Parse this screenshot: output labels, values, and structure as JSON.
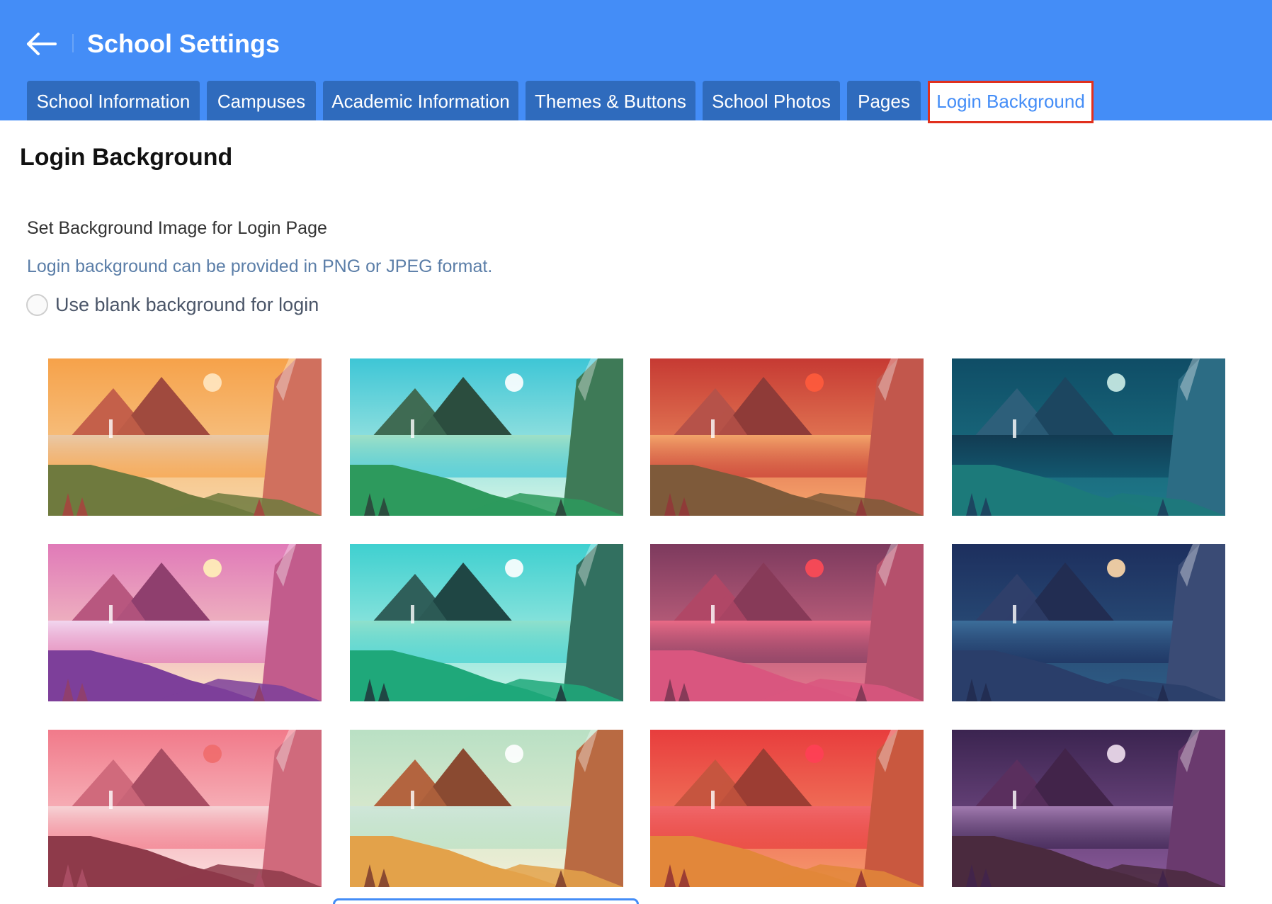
{
  "header": {
    "title": "School Settings",
    "back_icon": "arrow-left-icon",
    "bg_color": "#448df7"
  },
  "tabs": [
    {
      "label": "School Information",
      "active": false
    },
    {
      "label": "Campuses",
      "active": false
    },
    {
      "label": "Academic Information",
      "active": false
    },
    {
      "label": "Themes & Buttons",
      "active": false
    },
    {
      "label": "School Photos",
      "active": false
    },
    {
      "label": "Pages",
      "active": false
    },
    {
      "label": "Login Background",
      "active": true
    }
  ],
  "main": {
    "title": "Login Background",
    "section_label": "Set Background Image for Login Page",
    "hint": "Login background can be provided in PNG or JPEG format.",
    "blank_option_label": "Use blank background for login",
    "blank_option_checked": false
  },
  "backgrounds": [
    {
      "palette": {
        "sky1": "#f6a24a",
        "sky2": "#f7d6a8",
        "mtn": "#c4604a",
        "mtn2": "#a04a3e",
        "water": "#e9c9a8",
        "land": "#6f7a3e",
        "cliff": "#d0705e",
        "orb": "#ffe7c2"
      }
    },
    {
      "palette": {
        "sky1": "#3ec6d6",
        "sky2": "#d9f6e6",
        "mtn": "#3f6b53",
        "mtn2": "#2b4d3e",
        "water": "#9fe0c6",
        "land": "#2d9a5d",
        "cliff": "#3e7a57",
        "orb": "#ffffff"
      }
    },
    {
      "palette": {
        "sky1": "#c63a33",
        "sky2": "#f8a86e",
        "mtn": "#b65249",
        "mtn2": "#8f3b38",
        "water": "#f3a46a",
        "land": "#7e5a3a",
        "cliff": "#c2574c",
        "orb": "#ff5b3c"
      }
    },
    {
      "palette": {
        "sky1": "#0f4d66",
        "sky2": "#1f7a8a",
        "mtn": "#2d5f7a",
        "mtn2": "#1c4660",
        "water": "#123b52",
        "land": "#1c7a7a",
        "cliff": "#2c6c84",
        "orb": "#cdeee8"
      }
    },
    {
      "palette": {
        "sky1": "#e07ab8",
        "sky2": "#fbe4c6",
        "mtn": "#b8577f",
        "mtn2": "#8f3f6e",
        "water": "#f2d6ef",
        "land": "#7d3f9a",
        "cliff": "#c25c8c",
        "orb": "#fff2b8"
      }
    },
    {
      "palette": {
        "sky1": "#3fd0d0",
        "sky2": "#c9f3e6",
        "mtn": "#2f5f5a",
        "mtn2": "#1f4644",
        "water": "#8fe0cc",
        "land": "#1fa87a",
        "cliff": "#327060",
        "orb": "#ffffff"
      }
    },
    {
      "palette": {
        "sky1": "#7d3a5e",
        "sky2": "#e8798f",
        "mtn": "#b04766",
        "mtn2": "#873a58",
        "water": "#e96a86",
        "land": "#d9567f",
        "cliff": "#b5506c",
        "orb": "#ff4a55"
      }
    },
    {
      "palette": {
        "sky1": "#1d2f5e",
        "sky2": "#2f5e86",
        "mtn": "#2f3f6a",
        "mtn2": "#222d52",
        "water": "#3c6e9a",
        "land": "#2a3e6a",
        "cliff": "#3a4b75",
        "orb": "#ffd9a8"
      }
    },
    {
      "palette": {
        "sky1": "#f17a8a",
        "sky2": "#fbe0e0",
        "mtn": "#d06a7c",
        "mtn2": "#a94d63",
        "water": "#f6d3d6",
        "land": "#8e3a4a",
        "cliff": "#d06a7c",
        "orb": "#f06c6c"
      }
    },
    {
      "palette": {
        "sky1": "#b9e0c4",
        "sky2": "#f2efd6",
        "mtn": "#b3643f",
        "mtn2": "#8a4a31",
        "water": "#cfe6d9",
        "land": "#e3a24a",
        "cliff": "#b96a42",
        "orb": "#ffffff"
      }
    },
    {
      "palette": {
        "sky1": "#e83d3d",
        "sky2": "#f69a6e",
        "mtn": "#c6553f",
        "mtn2": "#9c3d33",
        "water": "#f0676a",
        "land": "#e2873a",
        "cliff": "#c9583f",
        "orb": "#ff3f55"
      }
    },
    {
      "palette": {
        "sky1": "#3b2450",
        "sky2": "#8a5a9a",
        "mtn": "#5a2f5e",
        "mtn2": "#42244a",
        "water": "#a27bb0",
        "land": "#4a2a3e",
        "cliff": "#6a3a6e",
        "orb": "#f1e0f0"
      }
    }
  ]
}
